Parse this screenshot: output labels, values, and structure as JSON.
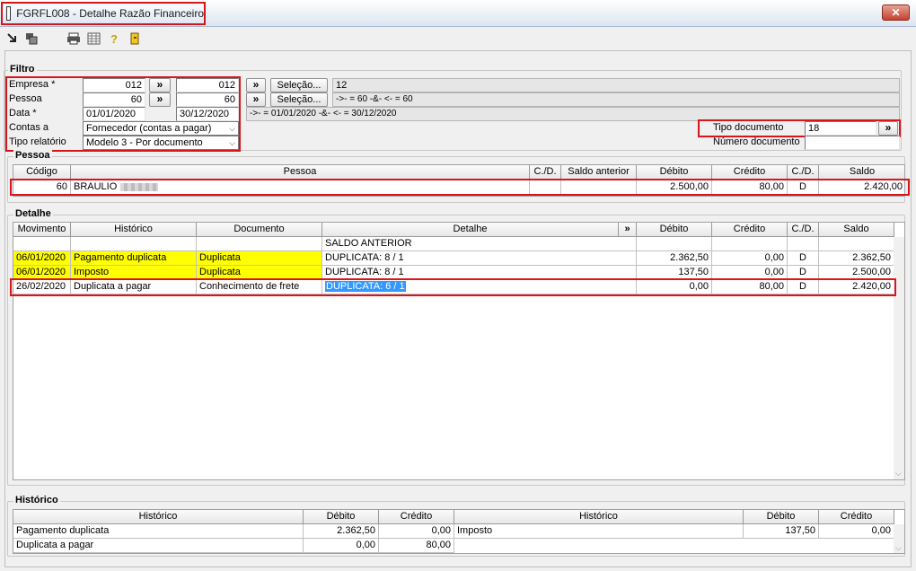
{
  "window": {
    "title": "FGRFL008 - Detalhe Razão Financeiro",
    "close_label": "✕"
  },
  "toolbar": {
    "icons": [
      "export-icon",
      "copy-icon",
      "print-icon",
      "grid-icon",
      "help-icon",
      "exit-icon"
    ]
  },
  "filtro": {
    "group_label": "Filtro",
    "empresa_label": "Empresa *",
    "empresa_from": "012",
    "empresa_to": "012",
    "pessoa_label": "Pessoa",
    "pessoa_from": "60",
    "pessoa_to": "60",
    "data_label": "Data *",
    "data_from": "01/01/2020",
    "data_to": "30/12/2020",
    "contas_label": "Contas a",
    "contas_value": "Fornecedor (contas a pagar)",
    "tipo_relatorio_label": "Tipo relatório",
    "tipo_relatorio_value": "Modelo 3 - Por documento",
    "arrow_label": "»",
    "selecao_label": "Seleção...",
    "selecao_empresa_text": "12",
    "selecao_pessoa_text": "->- = 60 -&- <- = 60",
    "data_range_text": "->- = 01/01/2020 -&- <- = 30/12/2020",
    "tipo_documento_label": "Tipo documento",
    "tipo_documento_value": "18",
    "numero_documento_label": "Número documento"
  },
  "pessoa": {
    "group_label": "Pessoa",
    "headers": [
      "Código",
      "Pessoa",
      "C./D.",
      "Saldo anterior",
      "Débito",
      "Crédito",
      "C./D.",
      "Saldo"
    ],
    "row": {
      "codigo": "60",
      "pessoa": "BRAULIO",
      "cd1": "",
      "saldo_anterior": "",
      "debito": "2.500,00",
      "credito": "80,00",
      "cd2": "D",
      "saldo": "2.420,00"
    }
  },
  "detalhe": {
    "group_label": "Detalhe",
    "headers": [
      "Movimento",
      "Histórico",
      "Documento",
      "Detalhe",
      "»",
      "Débito",
      "Crédito",
      "C./D.",
      "Saldo"
    ],
    "rows": [
      {
        "movimento": "",
        "historico": "",
        "documento": "",
        "detalhe": "SALDO ANTERIOR",
        "debito": "",
        "credito": "",
        "cd": "",
        "saldo": ""
      },
      {
        "movimento": "06/01/2020",
        "historico": "Pagamento duplicata",
        "documento": "Duplicata",
        "detalhe": "DUPLICATA: 8 / 1",
        "debito": "2.362,50",
        "credito": "0,00",
        "cd": "D",
        "saldo": "2.362,50"
      },
      {
        "movimento": "06/01/2020",
        "historico": "Imposto",
        "documento": "Duplicata",
        "detalhe": "DUPLICATA: 8 / 1",
        "debito": "137,50",
        "credito": "0,00",
        "cd": "D",
        "saldo": "2.500,00"
      },
      {
        "movimento": "26/02/2020",
        "historico": "Duplicata a pagar",
        "documento": "Conhecimento de frete",
        "detalhe": "DUPLICATA: 6 / 1",
        "debito": "0,00",
        "credito": "80,00",
        "cd": "D",
        "saldo": "2.420,00"
      }
    ]
  },
  "historico": {
    "group_label": "Histórico",
    "left_headers": [
      "Histórico",
      "Débito",
      "Crédito"
    ],
    "right_headers": [
      "Histórico",
      "Débito",
      "Crédito"
    ],
    "left_rows": [
      {
        "historico": "Pagamento duplicata",
        "debito": "2.362,50",
        "credito": "0,00"
      },
      {
        "historico": "Duplicata a pagar",
        "debito": "0,00",
        "credito": "80,00"
      }
    ],
    "right_rows": [
      {
        "historico": "Imposto",
        "debito": "137,50",
        "credito": "0,00"
      }
    ]
  },
  "colors": {
    "highlight_yellow": "#ffff00",
    "annotation_red": "#d7161c",
    "selection_blue": "#3399ff"
  }
}
